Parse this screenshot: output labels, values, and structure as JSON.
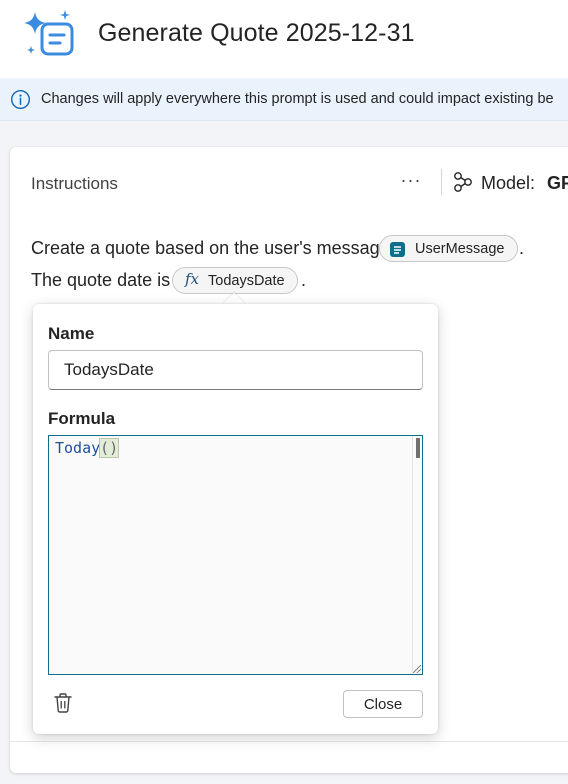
{
  "header": {
    "title": "Generate Quote 2025-12-31",
    "logo_icon": "sparkle-document-icon"
  },
  "banner": {
    "icon": "info-icon",
    "text": "Changes will apply everywhere this prompt is used and could impact existing be"
  },
  "instructions": {
    "title": "Instructions",
    "more_label": "···",
    "model_label": "Model:",
    "model_value": "GP",
    "line1_text": "Create a quote based on the user's message",
    "line1_chip": "UserMessage",
    "line2_text": "The quote date is",
    "line2_chip": "TodaysDate",
    "period": ".",
    "fx_symbol": "fx"
  },
  "popup": {
    "name_label": "Name",
    "name_value": "TodaysDate",
    "formula_label": "Formula",
    "formula_fn": "Today",
    "formula_parens": "()",
    "close_label": "Close"
  },
  "colors": {
    "accent": "#0f6e8a",
    "banner_bg": "#eaf2fb",
    "logo_blue": "#3b8be0"
  }
}
